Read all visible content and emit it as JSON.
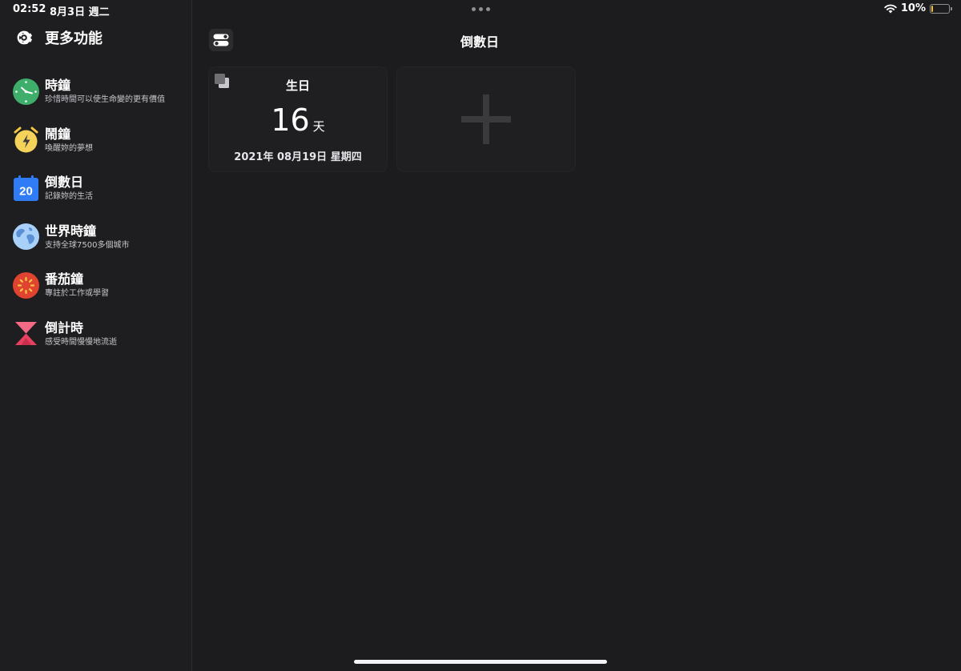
{
  "status_bar": {
    "time": "02:52",
    "date": "8月3日 週二",
    "battery_percent": "10%",
    "battery_level": 0.1,
    "battery_color": "#f5c518"
  },
  "sidebar": {
    "title": "更多功能",
    "title_icon": "gear-icon",
    "items": [
      {
        "label": "時鐘",
        "subtitle": "珍惜時間可以使生命變的更有價值",
        "icon": "clock-icon",
        "color": "#3fae6a"
      },
      {
        "label": "鬧鐘",
        "subtitle": "喚醒妳的夢想",
        "icon": "alarm-icon",
        "color": "#f5c542"
      },
      {
        "label": "倒數日",
        "subtitle": "記錄妳的生活",
        "icon": "calendar-icon",
        "icon_text": "20",
        "color": "#2f7cf6"
      },
      {
        "label": "世界時鐘",
        "subtitle": "支持全球7500多個城市",
        "icon": "globe-icon",
        "color": "#8ec0f5"
      },
      {
        "label": "番茄鐘",
        "subtitle": "專註於工作或學習",
        "icon": "tomato-icon",
        "color": "#e0432f"
      },
      {
        "label": "倒計時",
        "subtitle": "感受時間慢慢地流逝",
        "icon": "hourglass-icon",
        "color": "#f0506e"
      }
    ]
  },
  "main": {
    "title": "倒數日",
    "toggle_icon": "toggle-icon",
    "cards": [
      {
        "title": "生日",
        "days": "16",
        "unit": "天",
        "date": "2021年 08月19日 星期四",
        "corner_icon": "copy-icon"
      }
    ],
    "add_card_icon": "plus-icon"
  }
}
